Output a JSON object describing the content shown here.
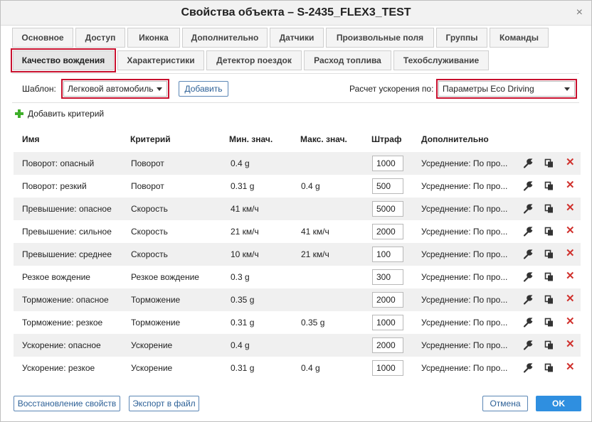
{
  "window": {
    "title": "Свойства объекта – S-2435_FLEX3_TEST",
    "close": "×"
  },
  "tabs_row1": [
    "Основное",
    "Доступ",
    "Иконка",
    "Дополнительно",
    "Датчики",
    "Произвольные поля",
    "Группы",
    "Команды"
  ],
  "tabs_row2": [
    "Качество вождения",
    "Характеристики",
    "Детектор поездок",
    "Расход топлива",
    "Техобслуживание"
  ],
  "active_tab": "Качество вождения",
  "toolbar": {
    "template_label": "Шаблон:",
    "template_value": "Легковой автомобиль",
    "add_button": "Добавить",
    "accel_label": "Расчет ускорения по:",
    "accel_value": "Параметры Eco Driving"
  },
  "add_criterion": "Добавить критерий",
  "table": {
    "headers": [
      "Имя",
      "Критерий",
      "Мин. знач.",
      "Макс. знач.",
      "Штраф",
      "Дополнительно"
    ],
    "rows": [
      {
        "name": "Поворот: опасный",
        "criterion": "Поворот",
        "min": "0.4 g",
        "max": "",
        "penalty": "1000",
        "extra": "Усреднение: По про..."
      },
      {
        "name": "Поворот: резкий",
        "criterion": "Поворот",
        "min": "0.31 g",
        "max": "0.4 g",
        "penalty": "500",
        "extra": "Усреднение: По про..."
      },
      {
        "name": "Превышение: опасное",
        "criterion": "Скорость",
        "min": "41 км/ч",
        "max": "",
        "penalty": "5000",
        "extra": "Усреднение: По про..."
      },
      {
        "name": "Превышение: сильное",
        "criterion": "Скорость",
        "min": "21 км/ч",
        "max": "41 км/ч",
        "penalty": "2000",
        "extra": "Усреднение: По про..."
      },
      {
        "name": "Превышение: среднее",
        "criterion": "Скорость",
        "min": "10 км/ч",
        "max": "21 км/ч",
        "penalty": "100",
        "extra": "Усреднение: По про..."
      },
      {
        "name": "Резкое вождение",
        "criterion": "Резкое вождение",
        "min": "0.3 g",
        "max": "",
        "penalty": "300",
        "extra": "Усреднение: По про..."
      },
      {
        "name": "Торможение: опасное",
        "criterion": "Торможение",
        "min": "0.35 g",
        "max": "",
        "penalty": "2000",
        "extra": "Усреднение: По про..."
      },
      {
        "name": "Торможение: резкое",
        "criterion": "Торможение",
        "min": "0.31 g",
        "max": "0.35 g",
        "penalty": "1000",
        "extra": "Усреднение: По про..."
      },
      {
        "name": "Ускорение: опасное",
        "criterion": "Ускорение",
        "min": "0.4 g",
        "max": "",
        "penalty": "2000",
        "extra": "Усреднение: По про..."
      },
      {
        "name": "Ускорение: резкое",
        "criterion": "Ускорение",
        "min": "0.31 g",
        "max": "0.4 g",
        "penalty": "1000",
        "extra": "Усреднение: По про..."
      }
    ],
    "row_icons": [
      "wrench-icon",
      "copy-icon",
      "delete-icon"
    ]
  },
  "footer": {
    "restore": "Восстановление свойств",
    "export": "Экспорт в файл",
    "cancel": "Отмена",
    "ok": "OK"
  },
  "colors": {
    "highlight": "#c8102e",
    "primary": "#2f8fe0",
    "delete": "#d0312d",
    "add": "#3fae2a"
  }
}
